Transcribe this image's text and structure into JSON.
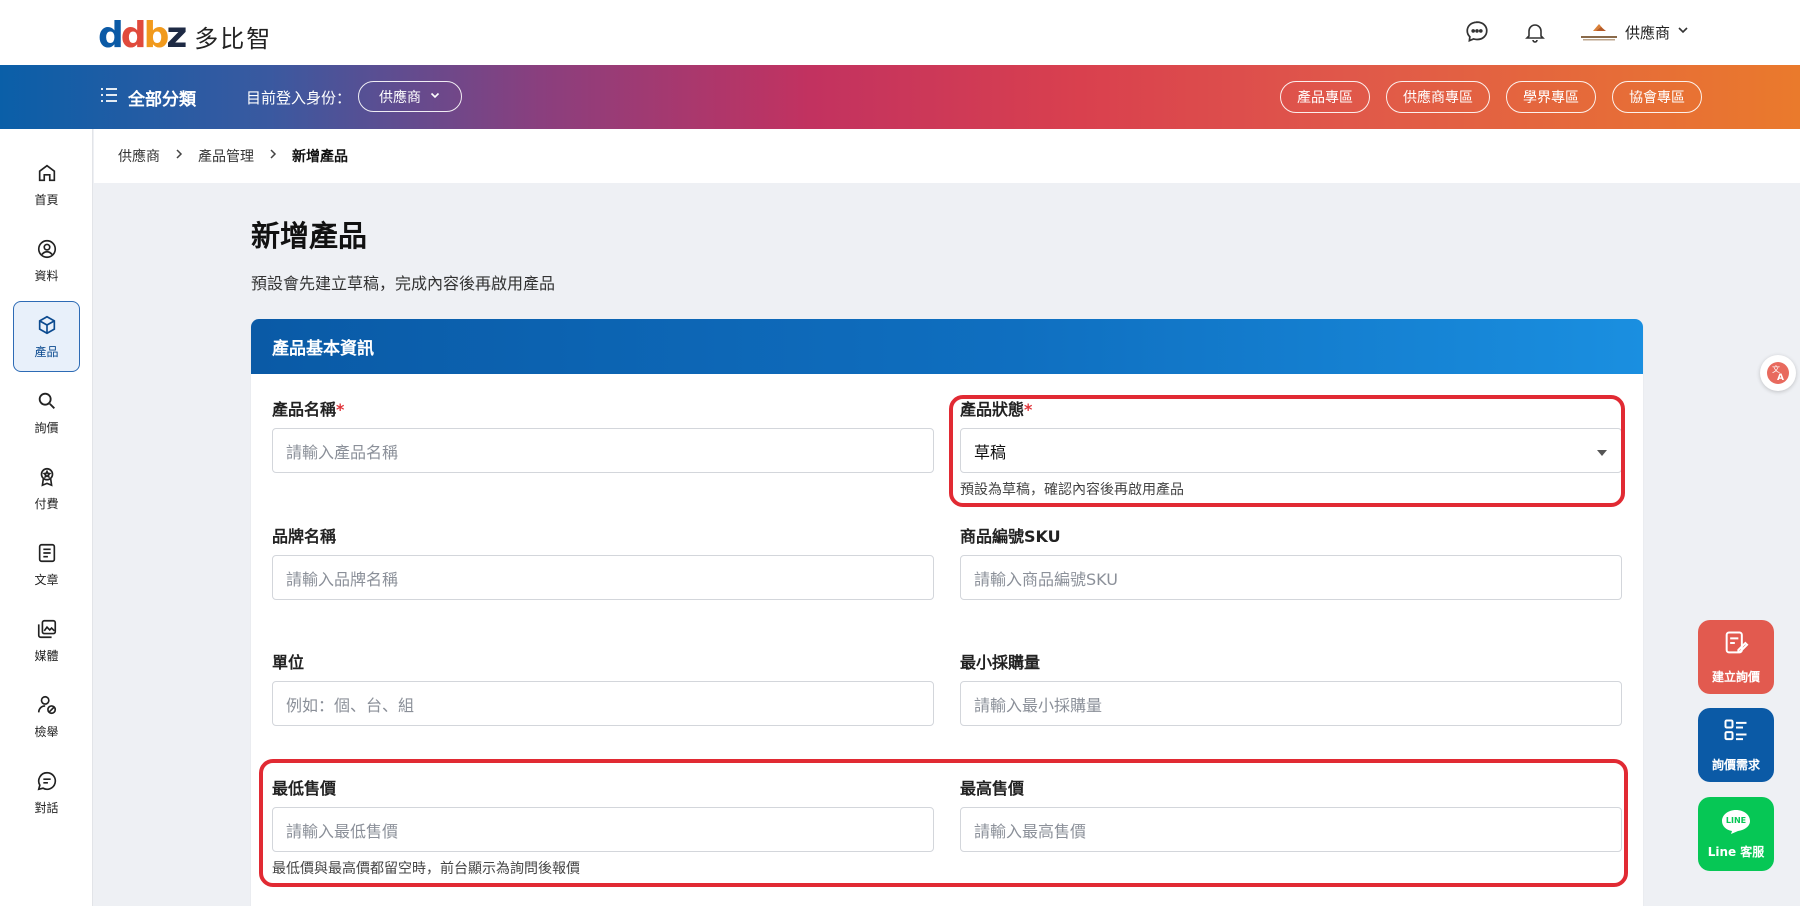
{
  "header": {
    "logo_text": "多比智",
    "account_name": "供應商"
  },
  "band": {
    "all_categories": "全部分類",
    "role_label": "目前登入身份：",
    "role_value": "供應商",
    "zones": [
      "產品專區",
      "供應商專區",
      "學界專區",
      "協會專區"
    ]
  },
  "sidebar": {
    "items": [
      {
        "label": "首頁",
        "icon": "home-icon"
      },
      {
        "label": "資料",
        "icon": "user-circle-icon"
      },
      {
        "label": "產品",
        "icon": "box-icon"
      },
      {
        "label": "詢價",
        "icon": "search-icon"
      },
      {
        "label": "付費",
        "icon": "badge-icon"
      },
      {
        "label": "文章",
        "icon": "article-icon"
      },
      {
        "label": "媒體",
        "icon": "media-icon"
      },
      {
        "label": "檢舉",
        "icon": "report-icon"
      },
      {
        "label": "對話",
        "icon": "chat-icon"
      }
    ],
    "active_index": 2
  },
  "breadcrumb": [
    "供應商",
    "產品管理",
    "新增產品"
  ],
  "page": {
    "title": "新增產品",
    "subtitle": "預設會先建立草稿，完成內容後再啟用產品"
  },
  "card": {
    "title": "產品基本資訊",
    "fields": {
      "name": {
        "label": "產品名稱",
        "placeholder": "請輸入產品名稱"
      },
      "status": {
        "label": "產品狀態",
        "value": "草稿",
        "help": "預設為草稿，確認內容後再啟用產品"
      },
      "brand": {
        "label": "品牌名稱",
        "placeholder": "請輸入品牌名稱"
      },
      "sku": {
        "label": "商品編號SKU",
        "placeholder": "請輸入商品編號SKU"
      },
      "unit": {
        "label": "單位",
        "placeholder": "例如：個、台、組"
      },
      "moq": {
        "label": "最小採購量",
        "placeholder": "請輸入最小採購量"
      },
      "min_price": {
        "label": "最低售價",
        "placeholder": "請輸入最低售價"
      },
      "max_price": {
        "label": "最高售價",
        "placeholder": "請輸入最高售價"
      },
      "price_help": "最低價與最高價都留空時，前台顯示為詢問後報價"
    }
  },
  "fabs": {
    "create_inquiry": "建立詢價",
    "inquiry_demand": "詢價需求",
    "line_service": "Line 客服",
    "line_badge": "LINE"
  },
  "colors": {
    "brand_blue": "#0a5fa8",
    "highlight_red": "#e12a33",
    "fab_red": "#e25a4f",
    "fab_blue": "#0b5aa6",
    "fab_green": "#06c755"
  }
}
